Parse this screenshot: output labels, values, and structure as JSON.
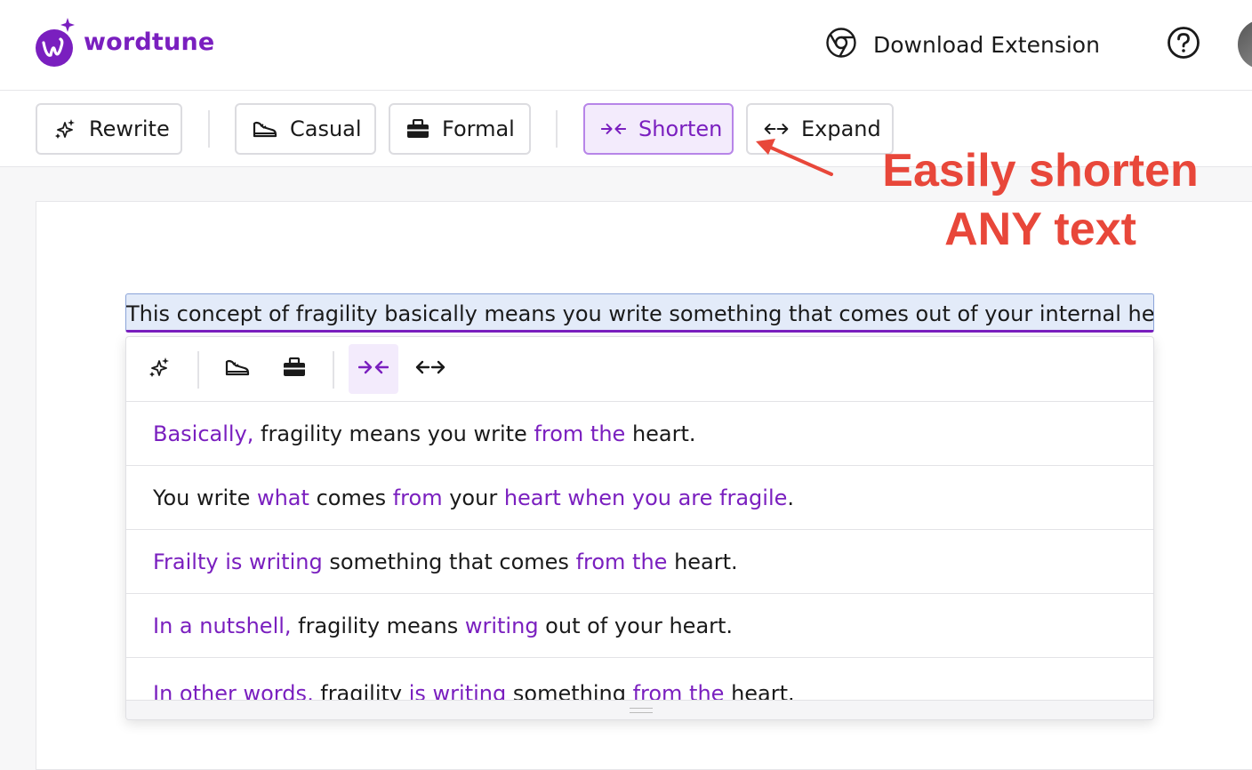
{
  "header": {
    "brand": "wordtune",
    "download_label": "Download Extension"
  },
  "colors": {
    "accent": "#7a1fbf",
    "annotation": "#e8473a"
  },
  "toolbar": {
    "rewrite": "Rewrite",
    "casual": "Casual",
    "formal": "Formal",
    "shorten": "Shorten",
    "expand": "Expand",
    "active": "Shorten"
  },
  "annotation": {
    "line1": "Easily shorten",
    "line2": "ANY text"
  },
  "editor": {
    "selected_text": "This concept of fragility basically means you write something that comes out of your internal heart."
  },
  "suggestions": [
    [
      {
        "t": "Basically,",
        "h": true
      },
      {
        "t": " fragility means you write ",
        "h": false
      },
      {
        "t": "from the",
        "h": true
      },
      {
        "t": " heart.",
        "h": false
      }
    ],
    [
      {
        "t": "You write ",
        "h": false
      },
      {
        "t": "what",
        "h": true
      },
      {
        "t": " comes ",
        "h": false
      },
      {
        "t": "from",
        "h": true
      },
      {
        "t": " your ",
        "h": false
      },
      {
        "t": "heart when you are fragile",
        "h": true
      },
      {
        "t": ".",
        "h": false
      }
    ],
    [
      {
        "t": "Frailty is writing",
        "h": true
      },
      {
        "t": " something that comes ",
        "h": false
      },
      {
        "t": "from the",
        "h": true
      },
      {
        "t": " heart.",
        "h": false
      }
    ],
    [
      {
        "t": "In a nutshell,",
        "h": true
      },
      {
        "t": " fragility means ",
        "h": false
      },
      {
        "t": "writing",
        "h": true
      },
      {
        "t": " out of your heart.",
        "h": false
      }
    ],
    [
      {
        "t": "In other words,",
        "h": true
      },
      {
        "t": " fragility ",
        "h": false
      },
      {
        "t": "is writing",
        "h": true
      },
      {
        "t": " something ",
        "h": false
      },
      {
        "t": "from the",
        "h": true
      },
      {
        "t": " heart.",
        "h": false
      }
    ]
  ]
}
